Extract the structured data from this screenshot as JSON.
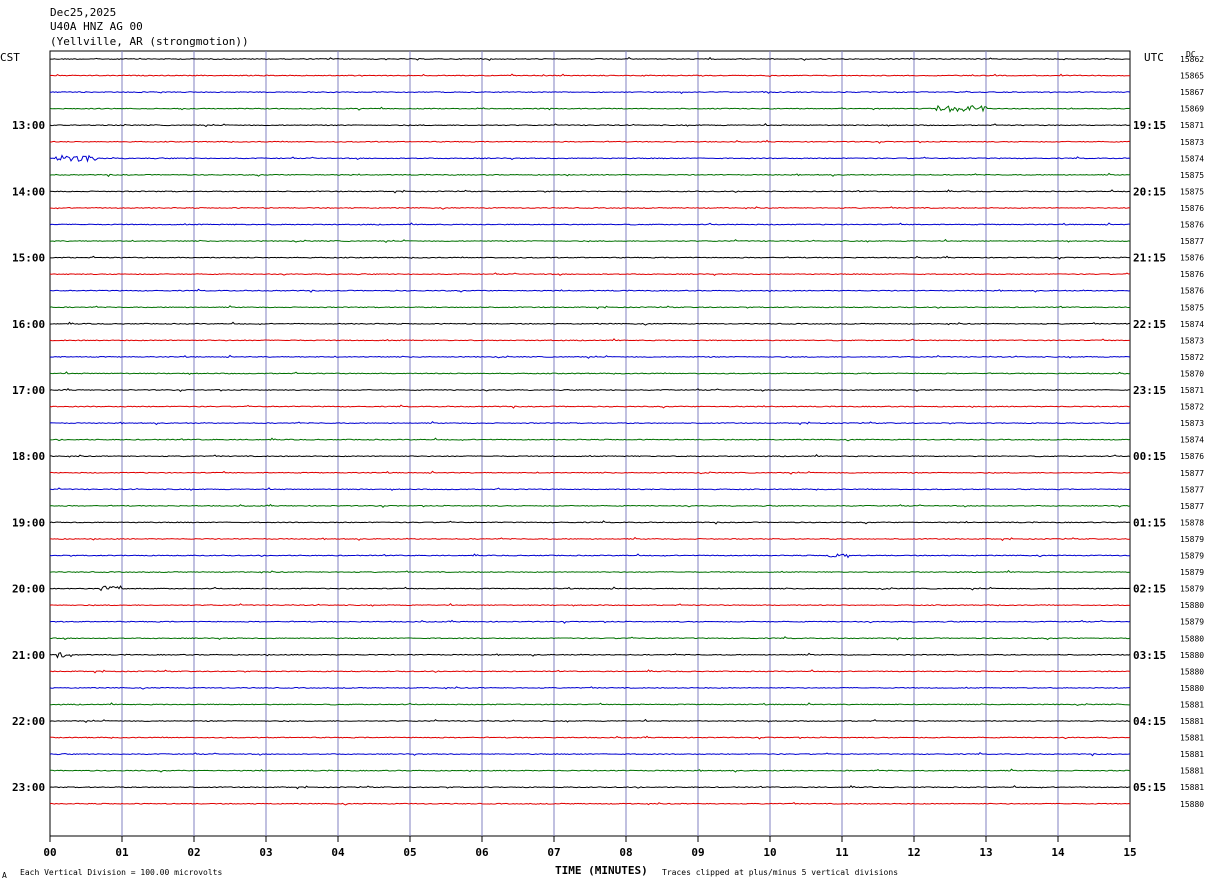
{
  "header": {
    "date": "Dec25,2025",
    "station": "U40A HNZ AG 00",
    "location": "(Yellville, AR (strongmotion))"
  },
  "left_tz": "CST",
  "right_tz": "UTC",
  "dc_label": "DC",
  "footer": {
    "scale_note": "Each Vertical Division =  100.00 microvolts",
    "clip_note": "Traces clipped at plus/minus 5 vertical divisions",
    "corner_mark": "A"
  },
  "colors": {
    "trace_cycle": [
      "#000000",
      "#e00000",
      "#0000d0",
      "#007000"
    ],
    "grid": "#8080c0"
  },
  "chart_data": {
    "type": "line",
    "title": "U40A HNZ AG 00",
    "xlabel": "TIME (MINUTES)",
    "ylabel": "",
    "xlim": [
      0,
      15
    ],
    "x_ticks": [
      "00",
      "01",
      "02",
      "03",
      "04",
      "05",
      "06",
      "07",
      "08",
      "09",
      "10",
      "11",
      "12",
      "13",
      "14",
      "15"
    ],
    "left_hour_labels": [
      "13:00",
      "14:00",
      "15:00",
      "16:00",
      "17:00",
      "18:00",
      "19:00",
      "20:00",
      "21:00",
      "22:00",
      "23:00"
    ],
    "right_hour_labels": [
      "19:15",
      "20:15",
      "21:15",
      "22:15",
      "23:15",
      "00:15",
      "01:15",
      "02:15",
      "03:15",
      "04:15",
      "05:15"
    ],
    "hour_label_first_trace": 4,
    "hour_label_every": 4,
    "dc_offsets": [
      15862,
      15865,
      15867,
      15869,
      15871,
      15873,
      15874,
      15875,
      15875,
      15876,
      15876,
      15877,
      15876,
      15876,
      15876,
      15875,
      15874,
      15873,
      15872,
      15870,
      15871,
      15872,
      15873,
      15874,
      15876,
      15877,
      15877,
      15877,
      15878,
      15879,
      15879,
      15879,
      15879,
      15880,
      15879,
      15880,
      15880,
      15880,
      15880,
      15881,
      15881,
      15881,
      15881,
      15881,
      15881,
      15880
    ],
    "events": [
      {
        "trace": 3,
        "start_min": 12.3,
        "end_min": 13.0,
        "amp": 3
      },
      {
        "trace": 6,
        "start_min": 0.05,
        "end_min": 0.65,
        "amp": 3
      },
      {
        "trace": 32,
        "start_min": 0.7,
        "end_min": 1.0,
        "amp": 3
      },
      {
        "trace": 36,
        "start_min": 0.1,
        "end_min": 0.3,
        "amp": 3
      },
      {
        "trace": 30,
        "start_min": 10.8,
        "end_min": 11.1,
        "amp": 2
      }
    ]
  }
}
